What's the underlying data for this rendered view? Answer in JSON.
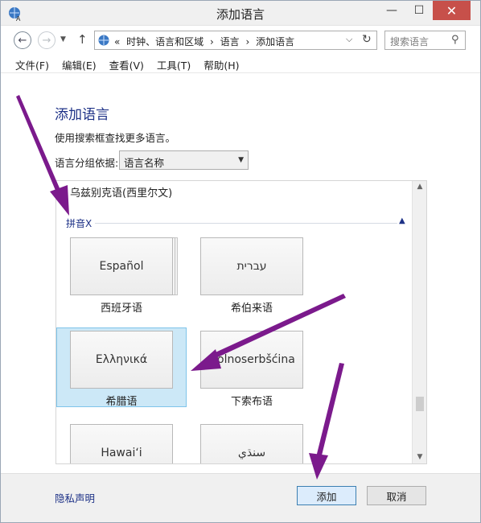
{
  "window": {
    "title": "添加语言",
    "minimize_icon": "minimize-icon",
    "maximize_icon": "maximize-icon",
    "close_icon": "close-icon"
  },
  "nav": {
    "address_prefix": "«",
    "breadcrumb": [
      "时钟、语言和区域",
      "语言",
      "添加语言"
    ],
    "separator": "›",
    "search_placeholder": "搜索语言"
  },
  "menu": {
    "items": [
      "文件(F)",
      "编辑(E)",
      "查看(V)",
      "工具(T)",
      "帮助(H)"
    ]
  },
  "page": {
    "heading": "添加语言",
    "subtext": "使用搜索框查找更多语言。",
    "group_by_label": "语言分组依据:",
    "group_by_value": "语言名称"
  },
  "list": {
    "previous_item": "乌兹别克语(西里尔文)",
    "group_header": "拼音X",
    "tiles": [
      {
        "native": "Español",
        "label": "西班牙语",
        "selected": false
      },
      {
        "native": "עברית",
        "label": "希伯来语",
        "selected": false
      },
      {
        "native": "Ελληνικά",
        "label": "希腊语",
        "selected": true
      },
      {
        "native": "Dolnoserbšćina",
        "label": "下索布语",
        "selected": false
      },
      {
        "native": "Hawaiʻi",
        "label": "",
        "selected": false
      },
      {
        "native": "سنڌي",
        "label": "",
        "selected": false
      }
    ]
  },
  "footer": {
    "privacy_link": "隐私声明",
    "add_button": "添加",
    "cancel_button": "取消"
  },
  "colors": {
    "annotation_arrow": "#7b1a8c",
    "selection_fill": "#cce8f7",
    "link_blue": "#1e3287"
  }
}
